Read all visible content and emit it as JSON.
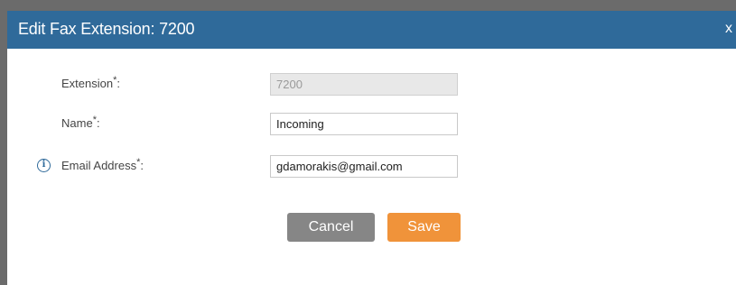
{
  "dialog": {
    "title": "Edit Fax Extension: 7200",
    "close_label": "x"
  },
  "form": {
    "extension": {
      "label": "Extension",
      "required_mark": "*",
      "suffix": ":",
      "value": "7200",
      "disabled": true
    },
    "name": {
      "label": "Name",
      "required_mark": "*",
      "suffix": ":",
      "value": "Incoming"
    },
    "email": {
      "label": "Email Address",
      "required_mark": "*",
      "suffix": ":",
      "value": "gdamorakis@gmail.com",
      "info_icon": "info-icon"
    }
  },
  "buttons": {
    "cancel_label": "Cancel",
    "save_label": "Save"
  },
  "colors": {
    "titlebar": "#2f6a9a",
    "cancel_button": "#868686",
    "save_button": "#f0933a"
  }
}
